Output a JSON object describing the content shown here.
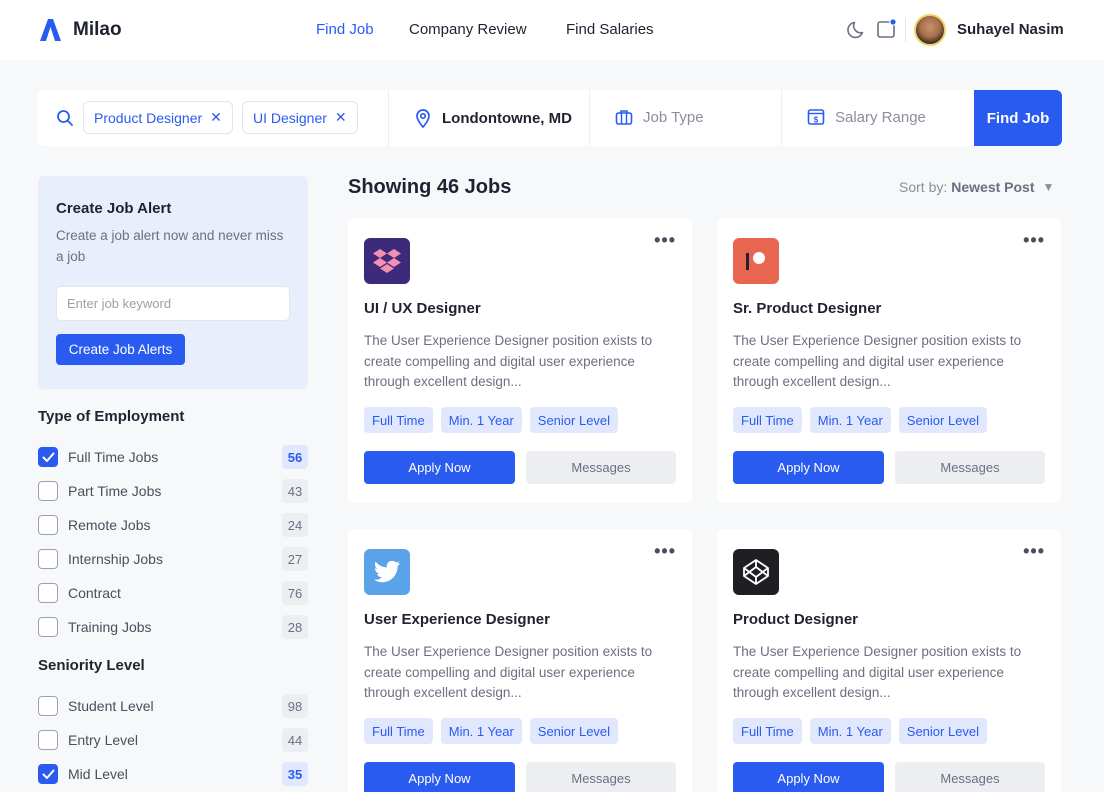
{
  "brand": {
    "name": "Milao",
    "accent": "#2a5bf0"
  },
  "nav": [
    {
      "label": "Find Job",
      "active": true
    },
    {
      "label": "Company Review",
      "active": false
    },
    {
      "label": "Find Salaries",
      "active": false
    }
  ],
  "user": {
    "name": "Suhayel Nasim"
  },
  "search": {
    "chips": [
      "Product Designer",
      "UI Designer"
    ],
    "location": "Londontowne, MD",
    "job_type_placeholder": "Job Type",
    "salary_placeholder": "Salary Range",
    "find_label": "Find Job"
  },
  "alert": {
    "title": "Create Job Alert",
    "description": "Create a job alert now and never miss a job",
    "input_placeholder": "Enter job keyword",
    "button_label": "Create Job Alerts"
  },
  "employment": {
    "title": "Type of Employment",
    "items": [
      {
        "label": "Full Time Jobs",
        "count": "56",
        "checked": true
      },
      {
        "label": "Part Time Jobs",
        "count": "43",
        "checked": false
      },
      {
        "label": "Remote Jobs",
        "count": "24",
        "checked": false
      },
      {
        "label": "Internship Jobs",
        "count": "27",
        "checked": false
      },
      {
        "label": "Contract",
        "count": "76",
        "checked": false
      },
      {
        "label": "Training Jobs",
        "count": "28",
        "checked": false
      }
    ]
  },
  "seniority": {
    "title": "Seniority Level",
    "items": [
      {
        "label": "Student Level",
        "count": "98",
        "checked": false
      },
      {
        "label": "Entry Level",
        "count": "44",
        "checked": false
      },
      {
        "label": "Mid Level",
        "count": "35",
        "checked": true
      }
    ]
  },
  "results": {
    "heading": "Showing 46 Jobs",
    "sort_prefix": "Sort by:",
    "sort_value": "Newest Post"
  },
  "jobs": [
    {
      "title": "UI / UX Designer",
      "logo": "dropbox-icon",
      "logo_color": "#3d2a7a",
      "description": "The User Experience Designer position exists to create compelling and digital user experience through excellent design...",
      "tags": [
        "Full Time",
        "Min. 1 Year",
        "Senior Level"
      ],
      "apply_label": "Apply Now",
      "messages_label": "Messages"
    },
    {
      "title": "Sr. Product Designer",
      "logo": "patreon-icon",
      "logo_color": "#e8664f",
      "description": "The User Experience Designer position exists to create compelling and digital user experience through excellent design...",
      "tags": [
        "Full Time",
        "Min. 1 Year",
        "Senior Level"
      ],
      "apply_label": "Apply Now",
      "messages_label": "Messages"
    },
    {
      "title": "User Experience Designer",
      "logo": "twitter-icon",
      "logo_color": "#5aa3e8",
      "description": "The User Experience Designer position exists to create compelling and digital user experience through excellent design...",
      "tags": [
        "Full Time",
        "Min. 1 Year",
        "Senior Level"
      ],
      "apply_label": "Apply Now",
      "messages_label": "Messages"
    },
    {
      "title": "Product Designer",
      "logo": "codepen-icon",
      "logo_color": "#1f1f23",
      "description": "The User Experience Designer position exists to create compelling and digital user experience through excellent design...",
      "tags": [
        "Full Time",
        "Min. 1 Year",
        "Senior Level"
      ],
      "apply_label": "Apply Now",
      "messages_label": "Messages"
    }
  ]
}
